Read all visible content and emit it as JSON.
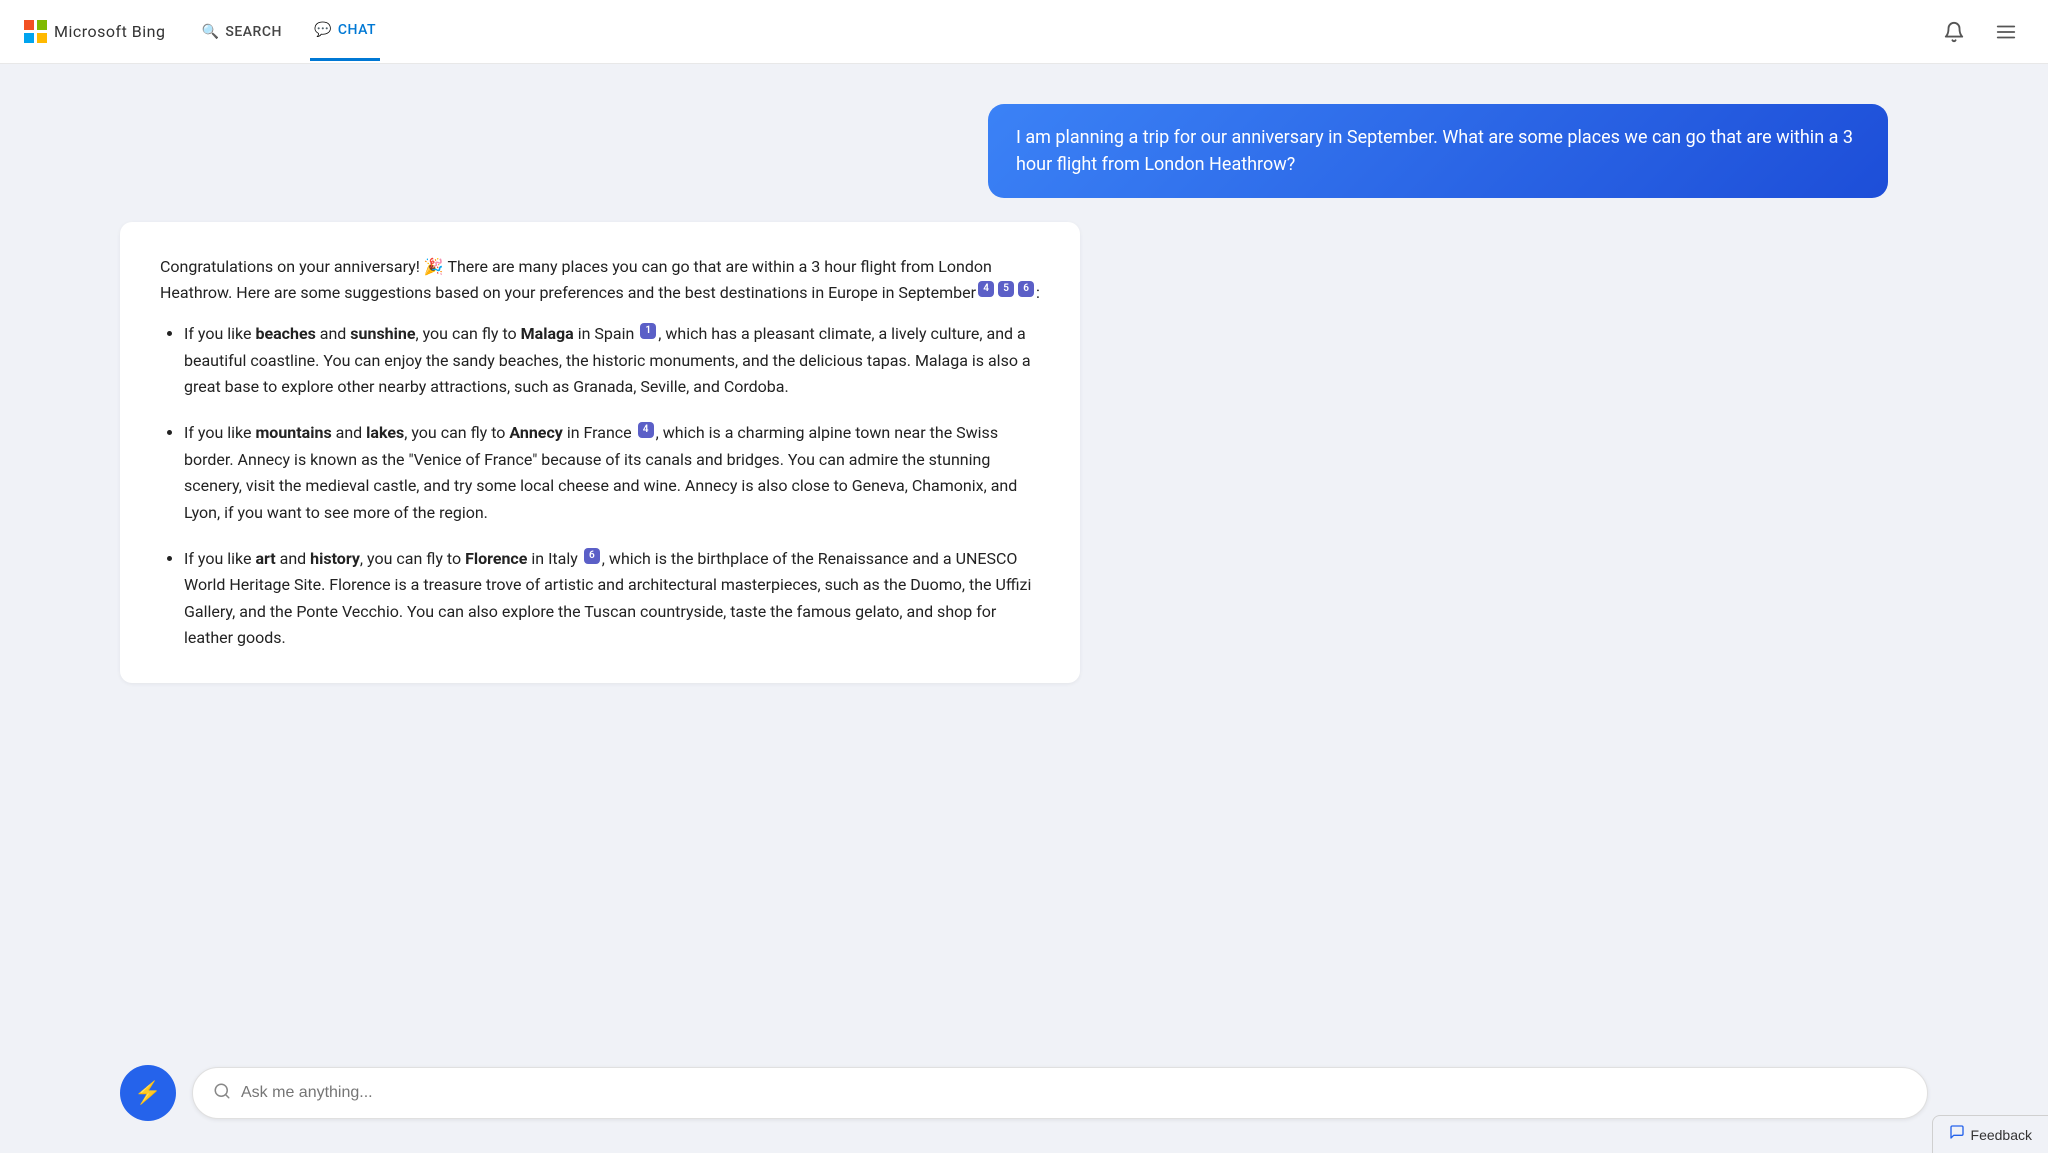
{
  "header": {
    "logo_text": "Microsoft Bing",
    "nav_items": [
      {
        "id": "search",
        "label": "SEARCH",
        "icon": "🔍",
        "active": false
      },
      {
        "id": "chat",
        "label": "CHAT",
        "icon": "💬",
        "active": true
      }
    ],
    "bell_title": "Notifications",
    "menu_title": "Menu"
  },
  "chat": {
    "user_message": "I am planning a trip for our anniversary in September. What are some places we can go that are within a 3 hour flight from London Heathrow?",
    "ai_intro": "Congratulations on your anniversary! 🎉 There are many places you can go that are within a 3 hour flight from London Heathrow. Here are some suggestions based on your preferences and the best destinations in Europe in September",
    "intro_citations": [
      "4",
      "5",
      "6"
    ],
    "suggestions": [
      {
        "prefix": "If you like ",
        "bold1": "beaches",
        "middle1": " and ",
        "bold2": "sunshine",
        "middle2": ", you can fly to ",
        "destination": "Malaga",
        "rest": " in Spain",
        "citation": "1",
        "detail": ", which has a pleasant climate, a lively culture, and a beautiful coastline. You can enjoy the sandy beaches, the historic monuments, and the delicious tapas. Malaga is also a great base to explore other nearby attractions, such as Granada, Seville, and Cordoba."
      },
      {
        "prefix": "If you like ",
        "bold1": "mountains",
        "middle1": " and ",
        "bold2": "lakes",
        "middle2": ", you can fly to ",
        "destination": "Annecy",
        "rest": " in France",
        "citation": "4",
        "detail": ", which is a charming alpine town near the Swiss border. Annecy is known as the \"Venice of France\" because of its canals and bridges. You can admire the stunning scenery, visit the medieval castle, and try some local cheese and wine. Annecy is also close to Geneva, Chamonix, and Lyon, if you want to see more of the region."
      },
      {
        "prefix": "If you like ",
        "bold1": "art",
        "middle1": " and ",
        "bold2": "history",
        "middle2": ", you can fly to ",
        "destination": "Florence",
        "rest": " in Italy",
        "citation": "6",
        "detail": ", which is the birthplace of the Renaissance and a UNESCO World Heritage Site. Florence is a treasure trove of artistic and architectural masterpieces, such as the Duomo, the Uffizi Gallery, and the Ponte Vecchio. You can also explore the Tuscan countryside, taste the famous gelato, and shop for leather goods."
      }
    ]
  },
  "input": {
    "placeholder": "Ask me anything...",
    "btn_aria": "Bing chat button"
  },
  "feedback": {
    "label": "Feedback"
  }
}
